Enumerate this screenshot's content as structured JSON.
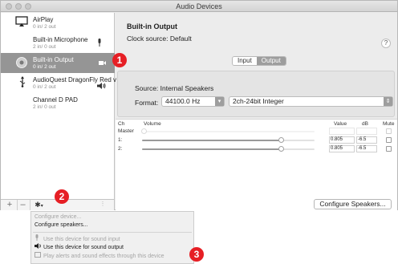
{
  "window": {
    "title": "Audio Devices"
  },
  "sidebar": {
    "devices": [
      {
        "name": "AirPlay",
        "channels": "0 in/ 2 out",
        "icon": "airplay-icon",
        "selected": false
      },
      {
        "name": "Built-in Microphone",
        "channels": "2 in/ 0 out",
        "icon": "microphone-icon",
        "selected": false
      },
      {
        "name": "Built-in Output",
        "channels": "0 in/ 2 out",
        "icon": "speaker-icon",
        "selected": true
      },
      {
        "name": "AudioQuest DragonFly Red v",
        "channels": "0 in/ 2 out",
        "icon": "usb-icon",
        "selected": false
      },
      {
        "name": "Channel D PAD",
        "channels": "2 in/ 0 out",
        "icon": "",
        "selected": false
      }
    ],
    "footer": {
      "add": "+",
      "remove": "–",
      "gear": "✱"
    }
  },
  "main": {
    "title": "Built-in Output",
    "clock_source": "Clock source: Default",
    "help": "?",
    "tabs": [
      {
        "label": "Input",
        "active": false
      },
      {
        "label": "Output",
        "active": true
      }
    ],
    "source": "Source: Internal Speakers",
    "format_label": "Format:",
    "format_rate": "44100.0 Hz",
    "format_bits": "2ch-24bit Integer",
    "table": {
      "headers": {
        "ch": "Ch",
        "volume": "Volume",
        "value": "Value",
        "db": "dB",
        "mute": "Mute"
      },
      "rows": [
        {
          "ch": "Master",
          "value": "",
          "db": "",
          "level": null
        },
        {
          "ch": "1:",
          "value": "0.805",
          "db": "-6.5",
          "level": 0.805
        },
        {
          "ch": "2:",
          "value": "0.805",
          "db": "-6.5",
          "level": 0.805
        }
      ]
    },
    "configure_button": "Configure Speakers..."
  },
  "menu": {
    "items": [
      {
        "label": "Configure device...",
        "enabled": false
      },
      {
        "label": "Configure speakers...",
        "enabled": true
      },
      {
        "label": "Use this device for sound input",
        "enabled": false,
        "icon": "microphone-icon"
      },
      {
        "label": "Use this device for sound output",
        "enabled": true,
        "icon": "speaker-icon"
      },
      {
        "label": "Play alerts and sound effects through this device",
        "enabled": false,
        "icon": "alert-icon"
      }
    ]
  },
  "callouts": [
    "1",
    "2",
    "3"
  ],
  "colors": {
    "badge": "#e61f25",
    "selection": "#959595",
    "slider_fill": "#9a9a9a"
  }
}
